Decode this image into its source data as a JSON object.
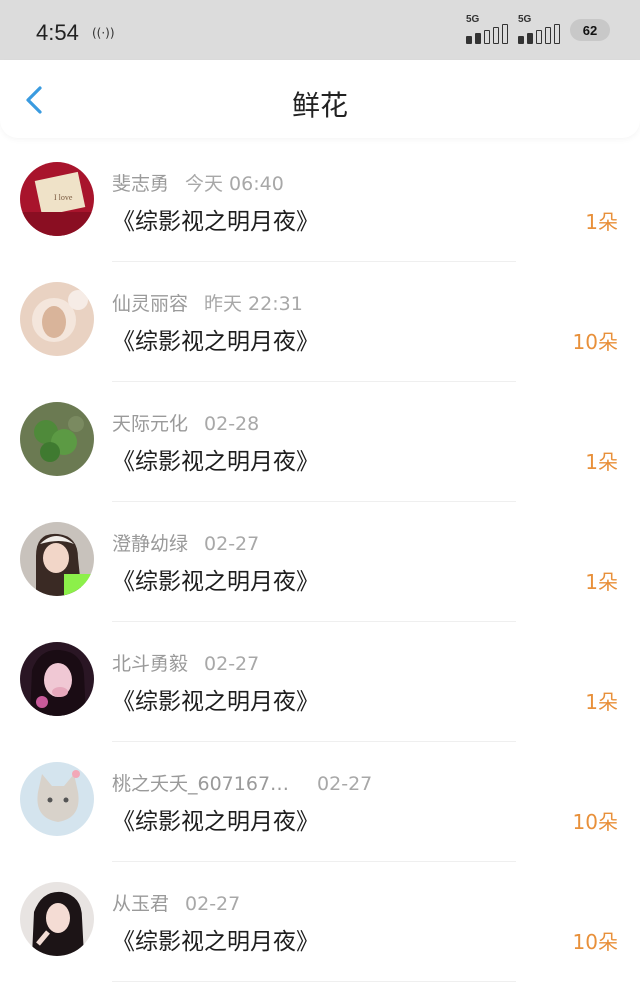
{
  "status": {
    "time": "4:54",
    "nfc": "((·))",
    "sim1": "5G",
    "sim2": "5G",
    "battery": "62"
  },
  "header": {
    "title": "鲜花",
    "back_icon": "chevron-left-icon",
    "accent": "#3a9be0"
  },
  "colors": {
    "count": "#e8903a",
    "name": "#9a9a9a"
  },
  "items": [
    {
      "name": "斐志勇",
      "time": "今天 06:40",
      "title": "《综影视之明月夜》",
      "count": "1朵"
    },
    {
      "name": "仙灵丽容",
      "time": "昨天 22:31",
      "title": "《综影视之明月夜》",
      "count": "10朵"
    },
    {
      "name": "天际元化",
      "time": "02-28",
      "title": "《综影视之明月夜》",
      "count": "1朵"
    },
    {
      "name": "澄静幼绿",
      "time": "02-27",
      "title": "《综影视之明月夜》",
      "count": "1朵"
    },
    {
      "name": "北斗勇毅",
      "time": "02-27",
      "title": "《综影视之明月夜》",
      "count": "1朵"
    },
    {
      "name": "桃之夭夭_607167…",
      "time": "02-27",
      "title": "《综影视之明月夜》",
      "count": "10朵"
    },
    {
      "name": "从玉君",
      "time": "02-27",
      "title": "《综影视之明月夜》",
      "count": "10朵"
    }
  ]
}
